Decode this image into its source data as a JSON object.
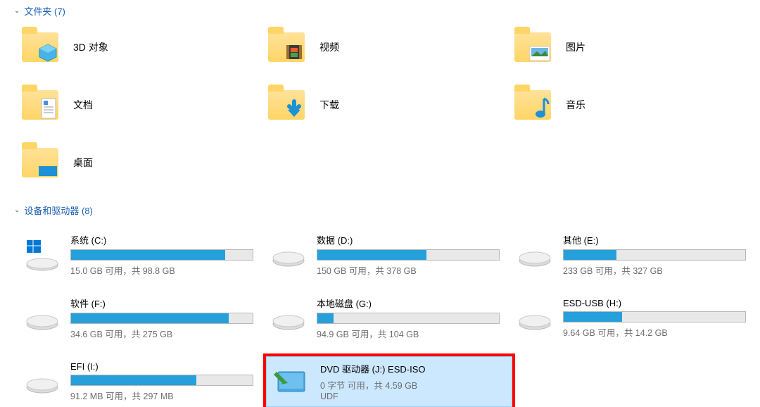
{
  "sections": {
    "folders": {
      "title": "文件夹 (7)"
    },
    "drives": {
      "title": "设备和驱动器 (8)"
    }
  },
  "folders": [
    {
      "label": "3D 对象",
      "icon": "3d"
    },
    {
      "label": "视频",
      "icon": "video"
    },
    {
      "label": "图片",
      "icon": "pictures"
    },
    {
      "label": "文档",
      "icon": "documents"
    },
    {
      "label": "下载",
      "icon": "downloads"
    },
    {
      "label": "音乐",
      "icon": "music"
    },
    {
      "label": "桌面",
      "icon": "desktop"
    }
  ],
  "drives": [
    {
      "name": "系统 (C:)",
      "sub": "15.0 GB 可用，共 98.8 GB",
      "fill_pct": 85,
      "icon": "win-drive"
    },
    {
      "name": "数据 (D:)",
      "sub": "150 GB 可用，共 378 GB",
      "fill_pct": 60,
      "icon": "drive"
    },
    {
      "name": "其他 (E:)",
      "sub": "233 GB 可用，共 327 GB",
      "fill_pct": 29,
      "icon": "drive"
    },
    {
      "name": "软件 (F:)",
      "sub": "34.6 GB 可用，共 275 GB",
      "fill_pct": 87,
      "icon": "drive"
    },
    {
      "name": "本地磁盘 (G:)",
      "sub": "94.9 GB 可用，共 104 GB",
      "fill_pct": 9,
      "icon": "drive"
    },
    {
      "name": "ESD-USB (H:)",
      "sub": "9.64 GB 可用，共 14.2 GB",
      "fill_pct": 32,
      "icon": "drive"
    },
    {
      "name": "EFI (I:)",
      "sub": "91.2 MB 可用，共 297 MB",
      "fill_pct": 69,
      "icon": "drive"
    },
    {
      "name": "DVD 驱动器 (J:) ESD-ISO",
      "sub": "0 字节 可用，共 4.59 GB",
      "sub2": "UDF",
      "icon": "dvd",
      "selected": true,
      "highlighted": true,
      "no_bar": true
    }
  ]
}
